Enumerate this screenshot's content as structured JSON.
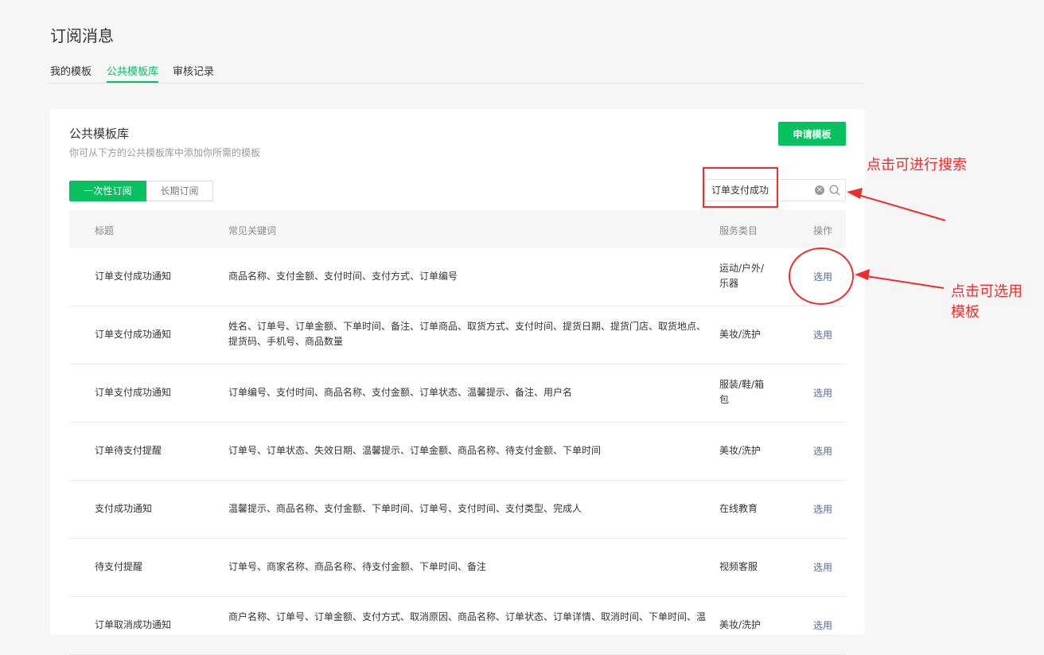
{
  "page": {
    "title": "订阅消息"
  },
  "tabs": [
    {
      "label": "我的模板"
    },
    {
      "label": "公共模板库"
    },
    {
      "label": "审核记录"
    }
  ],
  "library": {
    "title": "公共模板库",
    "description": "你可从下方的公共模板库中添加你所需的模板",
    "apply_button": "申请模板",
    "segments": [
      {
        "label": "一次性订阅"
      },
      {
        "label": "长期订阅"
      }
    ],
    "search_value": "订单支付成功"
  },
  "table": {
    "headers": {
      "title": "标题",
      "keywords": "常见关键词",
      "category": "服务类目",
      "action": "操作"
    },
    "rows": [
      {
        "title": "订单支付成功通知",
        "keywords": "商品名称、支付金额、支付时间、支付方式、订单编号",
        "category_l1": "运动/户外/",
        "category_l2": "乐器",
        "action": "选用"
      },
      {
        "title": "订单支付成功通知",
        "keywords_l1": "姓名、订单号、订单金额、下单时间、备注、订单商品、取货方式、支付时间、提货日期、提货门店、取货地点、",
        "keywords_l2": "提货码、手机号、商品数量",
        "category": "美妆/洗护",
        "action": "选用"
      },
      {
        "title": "订单支付成功通知",
        "keywords": "订单编号、支付时间、商品名称、支付金额、订单状态、温馨提示、备注、用户名",
        "category_l1": "服装/鞋/箱",
        "category_l2": "包",
        "action": "选用"
      },
      {
        "title": "订单待支付提醒",
        "keywords": "订单号、订单状态、失效日期、温馨提示、订单金额、商品名称、待支付金额、下单时间",
        "category": "美妆/洗护",
        "action": "选用"
      },
      {
        "title": "支付成功通知",
        "keywords": "温馨提示、商品名称、支付金额、下单时间、订单号、支付时间、支付类型、完成人",
        "category": "在线教育",
        "action": "选用"
      },
      {
        "title": "待支付提醒",
        "keywords": "订单号、商家名称、商品名称、待支付金额、下单时间、备注",
        "category": "视频客服",
        "action": "选用"
      },
      {
        "title": "订单取消成功通知",
        "keywords_l1": "商户名称、订单号、订单金额、支付方式、取消原因、商品名称、订单状态、订单详情、取消时间、下单时间、温",
        "keywords_l2": "",
        "category": "美妆/洗护",
        "action": "选用"
      }
    ]
  },
  "annotations": {
    "search_note": "点击可进行搜索",
    "select_note_l1": "点击可选用",
    "select_note_l2": "模板",
    "color": "#f02c2c"
  },
  "colors": {
    "accent": "#07c160",
    "link": "#576b95"
  }
}
